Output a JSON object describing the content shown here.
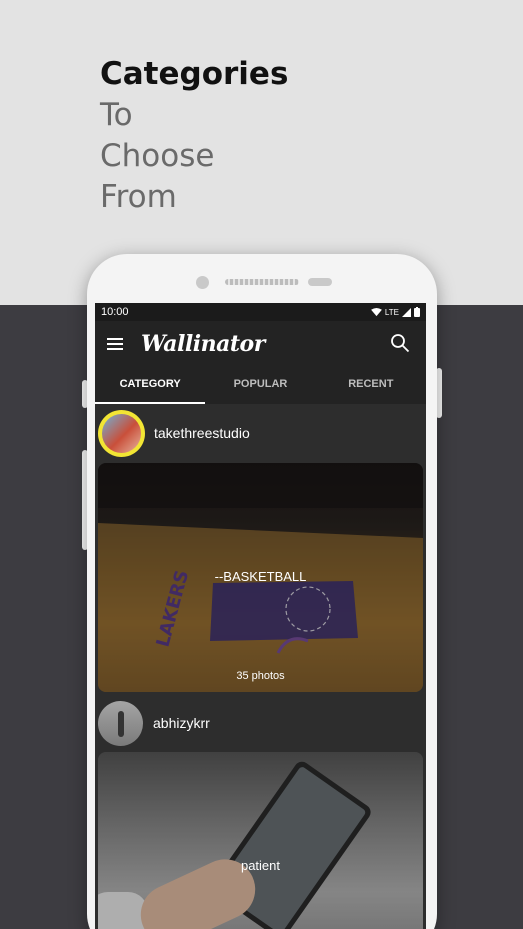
{
  "headline": {
    "line1": "Categories",
    "line2": "To",
    "line3": "Choose",
    "line4": "From"
  },
  "status_bar": {
    "time": "10:00",
    "network": "LTE"
  },
  "app": {
    "title": "Wallinator"
  },
  "tabs": [
    {
      "label": "CATEGORY",
      "active": true
    },
    {
      "label": "POPULAR",
      "active": false
    },
    {
      "label": "RECENT",
      "active": false
    }
  ],
  "posts": [
    {
      "username": "takethreestudio",
      "category_title": "--BASKETBALL",
      "photo_count": "35 photos"
    },
    {
      "username": "abhizykrr",
      "category_title": "patient"
    }
  ],
  "colors": {
    "accent_avatar_ring": "#f2e534",
    "screen_bg": "#2d2d2d",
    "appbar_bg": "#232323"
  }
}
